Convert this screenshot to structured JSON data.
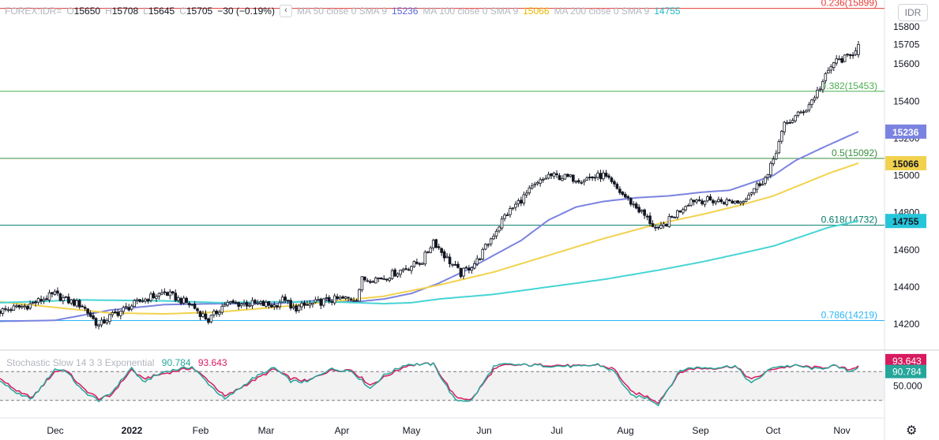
{
  "legend": {
    "symbol": "FOREX:IDR=",
    "o_label": "O",
    "o_value": "15650",
    "h_label": "H",
    "h_value": "15708",
    "l_label": "L",
    "l_value": "15645",
    "c_label": "C",
    "c_value": "15705",
    "change": "−30 (−0.19%)",
    "collapse_icon": "chevron-left-icon",
    "ma50_label": "MA 50 close 0 SMA 9",
    "ma50_value": "15236",
    "ma100_label": "MA 100 close 0 SMA 9",
    "ma100_value": "15066",
    "ma200_label": "MA 200 close 0 SMA 9",
    "ma200_value": "14755"
  },
  "currency_button": "IDR",
  "oscillator": {
    "label": "Stochastic Slow 14 3 3 Exponential",
    "k_value": "90.784",
    "d_value": "93.643",
    "axis_label": "50.000"
  },
  "settings_icon": "gear-icon",
  "colors": {
    "up": "#ffffff",
    "down": "#131722",
    "ma50": "#7b83e0",
    "ma100": "#f2d24d",
    "ma200": "#47d4d4",
    "fib236": "#e53935",
    "fib382": "#4caf50",
    "fib5": "#388e3c",
    "fib618": "#00796b",
    "fib786": "#29b6f6",
    "stoch_k": "#26a69a",
    "stoch_d": "#d81b60",
    "price_label": "#131722"
  },
  "chart_data": {
    "type": "candlestick",
    "ylim": [
      14080,
      15950
    ],
    "yticks": [
      14200,
      14400,
      14600,
      14800,
      15000,
      15200,
      15400,
      15600,
      15800
    ],
    "yticks_visible": [
      "14200",
      "14400",
      "14600",
      "14800",
      "15000",
      "15200",
      "15400",
      "15600",
      "15800"
    ],
    "xticks": [
      {
        "label": "Dec",
        "bold": false
      },
      {
        "label": "2022",
        "bold": true
      },
      {
        "label": "Feb",
        "bold": false
      },
      {
        "label": "Mar",
        "bold": false
      },
      {
        "label": "Apr",
        "bold": false
      },
      {
        "label": "May",
        "bold": false
      },
      {
        "label": "Jun",
        "bold": false
      },
      {
        "label": "Jul",
        "bold": false
      },
      {
        "label": "Aug",
        "bold": false
      },
      {
        "label": "Sep",
        "bold": false
      },
      {
        "label": "Oct",
        "bold": false
      },
      {
        "label": "Nov",
        "bold": false
      }
    ],
    "price_waypoints": [
      [
        0,
        14270
      ],
      [
        10,
        14300
      ],
      [
        20,
        14360
      ],
      [
        24,
        14330
      ],
      [
        30,
        14300
      ],
      [
        36,
        14190
      ],
      [
        40,
        14240
      ],
      [
        52,
        14330
      ],
      [
        60,
        14370
      ],
      [
        70,
        14300
      ],
      [
        76,
        14220
      ],
      [
        82,
        14310
      ],
      [
        92,
        14310
      ],
      [
        100,
        14300
      ],
      [
        104,
        14340
      ],
      [
        106,
        14280
      ],
      [
        120,
        14330
      ],
      [
        130,
        14340
      ],
      [
        132,
        14440
      ],
      [
        140,
        14450
      ],
      [
        154,
        14540
      ],
      [
        158,
        14650
      ],
      [
        162,
        14570
      ],
      [
        168,
        14470
      ],
      [
        174,
        14540
      ],
      [
        184,
        14780
      ],
      [
        194,
        14930
      ],
      [
        200,
        15000
      ],
      [
        212,
        14980
      ],
      [
        220,
        15000
      ],
      [
        224,
        14940
      ],
      [
        234,
        14800
      ],
      [
        240,
        14700
      ],
      [
        244,
        14760
      ],
      [
        252,
        14870
      ],
      [
        266,
        14860
      ],
      [
        270,
        14860
      ],
      [
        280,
        15000
      ],
      [
        286,
        15270
      ],
      [
        294,
        15360
      ],
      [
        298,
        15450
      ],
      [
        304,
        15610
      ],
      [
        310,
        15640
      ],
      [
        313,
        15705
      ]
    ],
    "series": [
      {
        "name": "MA 50 close 0 SMA 9",
        "last": 15236,
        "waypoints": [
          [
            0,
            14215
          ],
          [
            20,
            14220
          ],
          [
            40,
            14275
          ],
          [
            60,
            14305
          ],
          [
            80,
            14310
          ],
          [
            100,
            14310
          ],
          [
            118,
            14330
          ],
          [
            130,
            14320
          ],
          [
            140,
            14335
          ],
          [
            150,
            14365
          ],
          [
            160,
            14420
          ],
          [
            170,
            14490
          ],
          [
            180,
            14570
          ],
          [
            190,
            14650
          ],
          [
            200,
            14760
          ],
          [
            210,
            14830
          ],
          [
            220,
            14860
          ],
          [
            226,
            14870
          ],
          [
            232,
            14880
          ],
          [
            244,
            14890
          ],
          [
            256,
            14910
          ],
          [
            266,
            14920
          ],
          [
            274,
            14960
          ],
          [
            282,
            15000
          ],
          [
            290,
            15080
          ],
          [
            300,
            15150
          ],
          [
            313,
            15236
          ]
        ]
      },
      {
        "name": "MA 100 close 0 SMA 9",
        "last": 15066,
        "waypoints": [
          [
            0,
            14320
          ],
          [
            20,
            14290
          ],
          [
            40,
            14260
          ],
          [
            60,
            14255
          ],
          [
            80,
            14265
          ],
          [
            100,
            14290
          ],
          [
            120,
            14320
          ],
          [
            140,
            14350
          ],
          [
            160,
            14410
          ],
          [
            180,
            14480
          ],
          [
            200,
            14570
          ],
          [
            220,
            14660
          ],
          [
            240,
            14740
          ],
          [
            256,
            14790
          ],
          [
            270,
            14840
          ],
          [
            282,
            14890
          ],
          [
            292,
            14950
          ],
          [
            302,
            15010
          ],
          [
            313,
            15066
          ]
        ]
      },
      {
        "name": "MA 200 close 0 SMA 9",
        "last": 14755,
        "waypoints": [
          [
            0,
            14315
          ],
          [
            30,
            14330
          ],
          [
            60,
            14325
          ],
          [
            80,
            14315
          ],
          [
            100,
            14320
          ],
          [
            120,
            14320
          ],
          [
            140,
            14310
          ],
          [
            150,
            14315
          ],
          [
            160,
            14335
          ],
          [
            180,
            14360
          ],
          [
            200,
            14400
          ],
          [
            220,
            14440
          ],
          [
            240,
            14490
          ],
          [
            256,
            14535
          ],
          [
            270,
            14580
          ],
          [
            282,
            14620
          ],
          [
            292,
            14670
          ],
          [
            302,
            14720
          ],
          [
            313,
            14755
          ]
        ]
      }
    ],
    "fib_levels": [
      {
        "label": "0.236(15899)",
        "value": 15899
      },
      {
        "label": "0.382(15453)",
        "value": 15453
      },
      {
        "label": "0.5(15092)",
        "value": 15092
      },
      {
        "label": "0.618(14732)",
        "value": 14732
      },
      {
        "label": "0.786(14219)",
        "value": 14219
      }
    ],
    "last_price": "15705",
    "axis_badges": [
      "15236",
      "15066",
      "14755"
    ],
    "stochastic": {
      "ylim": [
        0,
        100
      ],
      "upper": 80,
      "lower": 20,
      "k_last": 90.784,
      "d_last": 93.643,
      "k_waypoints": [
        [
          0,
          60
        ],
        [
          8,
          28
        ],
        [
          12,
          25
        ],
        [
          20,
          85
        ],
        [
          24,
          82
        ],
        [
          30,
          40
        ],
        [
          36,
          20
        ],
        [
          40,
          32
        ],
        [
          48,
          88
        ],
        [
          52,
          58
        ],
        [
          60,
          80
        ],
        [
          70,
          90
        ],
        [
          76,
          55
        ],
        [
          82,
          22
        ],
        [
          92,
          65
        ],
        [
          100,
          88
        ],
        [
          106,
          60
        ],
        [
          112,
          58
        ],
        [
          120,
          85
        ],
        [
          128,
          82
        ],
        [
          135,
          45
        ],
        [
          140,
          72
        ],
        [
          148,
          95
        ],
        [
          152,
          95
        ],
        [
          158,
          95
        ],
        [
          166,
          20
        ],
        [
          172,
          20
        ],
        [
          180,
          90
        ],
        [
          184,
          95
        ],
        [
          200,
          92
        ],
        [
          212,
          90
        ],
        [
          218,
          95
        ],
        [
          224,
          80
        ],
        [
          230,
          30
        ],
        [
          236,
          25
        ],
        [
          240,
          12
        ],
        [
          248,
          82
        ],
        [
          252,
          88
        ],
        [
          260,
          88
        ],
        [
          268,
          92
        ],
        [
          274,
          55
        ],
        [
          282,
          90
        ],
        [
          290,
          92
        ],
        [
          298,
          85
        ],
        [
          304,
          92
        ],
        [
          310,
          80
        ],
        [
          313,
          90
        ]
      ],
      "d_waypoints": [
        [
          0,
          65
        ],
        [
          8,
          33
        ],
        [
          12,
          27
        ],
        [
          20,
          80
        ],
        [
          24,
          84
        ],
        [
          30,
          46
        ],
        [
          36,
          24
        ],
        [
          40,
          28
        ],
        [
          48,
          84
        ],
        [
          52,
          65
        ],
        [
          60,
          76
        ],
        [
          70,
          88
        ],
        [
          76,
          62
        ],
        [
          82,
          28
        ],
        [
          92,
          60
        ],
        [
          100,
          85
        ],
        [
          106,
          66
        ],
        [
          112,
          60
        ],
        [
          120,
          82
        ],
        [
          128,
          84
        ],
        [
          135,
          52
        ],
        [
          140,
          68
        ],
        [
          148,
          92
        ],
        [
          152,
          95
        ],
        [
          158,
          96
        ],
        [
          166,
          27
        ],
        [
          172,
          22
        ],
        [
          180,
          84
        ],
        [
          184,
          93
        ],
        [
          200,
          94
        ],
        [
          212,
          91
        ],
        [
          218,
          94
        ],
        [
          224,
          85
        ],
        [
          230,
          38
        ],
        [
          236,
          28
        ],
        [
          240,
          16
        ],
        [
          248,
          78
        ],
        [
          252,
          86
        ],
        [
          260,
          87
        ],
        [
          268,
          91
        ],
        [
          274,
          63
        ],
        [
          282,
          86
        ],
        [
          290,
          92
        ],
        [
          298,
          88
        ],
        [
          304,
          91
        ],
        [
          310,
          84
        ],
        [
          313,
          93
        ]
      ]
    }
  }
}
